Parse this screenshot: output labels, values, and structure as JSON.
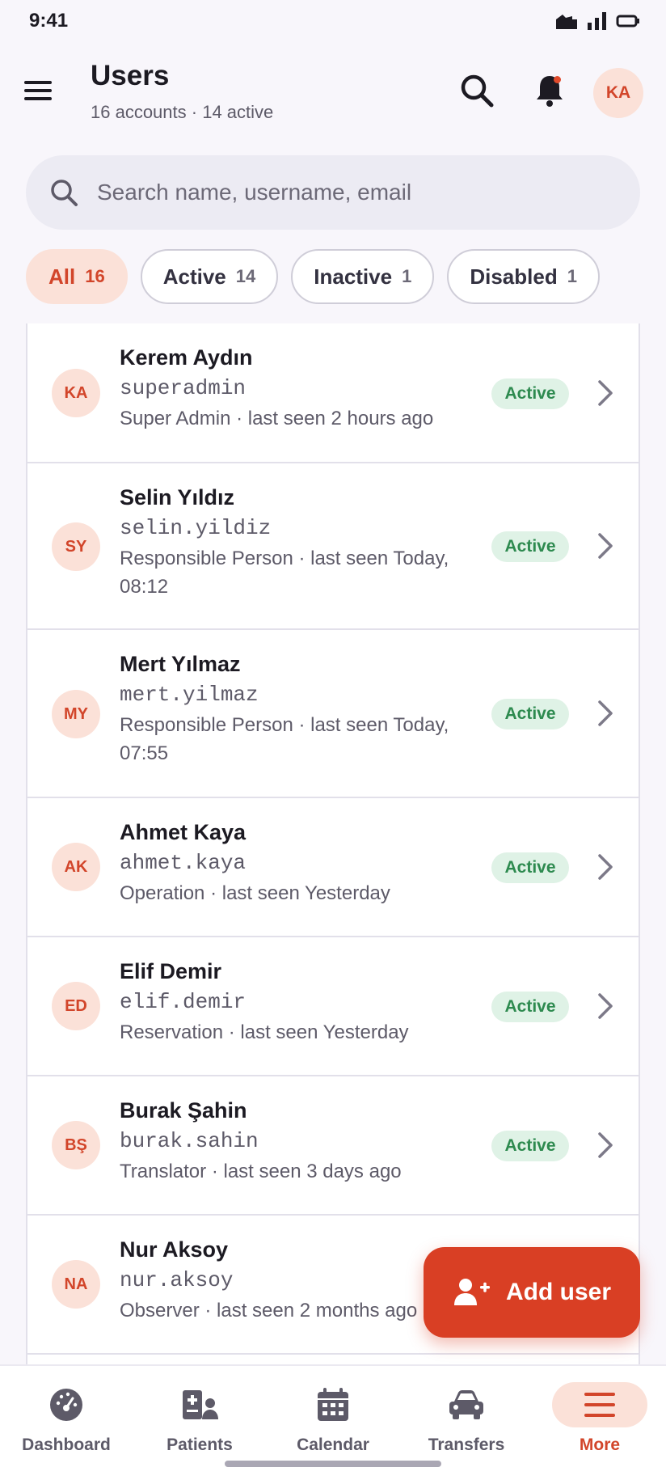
{
  "status_bar": {
    "time": "9:41"
  },
  "header": {
    "title": "Users",
    "subtitle_accounts": "16 accounts",
    "subtitle_sep": "·",
    "subtitle_active": "14 active",
    "avatar_initials": "KA"
  },
  "search": {
    "placeholder": "Search name, username, email"
  },
  "filters": [
    {
      "label": "All",
      "count": "16",
      "selected": true
    },
    {
      "label": "Active",
      "count": "14",
      "selected": false
    },
    {
      "label": "Inactive",
      "count": "1",
      "selected": false
    },
    {
      "label": "Disabled",
      "count": "1",
      "selected": false
    }
  ],
  "users": [
    {
      "initials": "KA",
      "name": "Kerem Aydın",
      "username": "superadmin",
      "role": "Super Admin",
      "last_seen": "last seen 2 hours ago",
      "status": "Active"
    },
    {
      "initials": "SY",
      "name": "Selin Yıldız",
      "username": "selin.yildiz",
      "role": "Responsible Person",
      "last_seen": "last seen Today, 08:12",
      "status": "Active"
    },
    {
      "initials": "MY",
      "name": "Mert Yılmaz",
      "username": "mert.yilmaz",
      "role": "Responsible Person",
      "last_seen": "last seen Today, 07:55",
      "status": "Active"
    },
    {
      "initials": "AK",
      "name": "Ahmet Kaya",
      "username": "ahmet.kaya",
      "role": "Operation",
      "last_seen": "last seen Yesterday",
      "status": "Active"
    },
    {
      "initials": "ED",
      "name": "Elif Demir",
      "username": "elif.demir",
      "role": "Reservation",
      "last_seen": "last seen Yesterday",
      "status": "Active"
    },
    {
      "initials": "BŞ",
      "name": "Burak Şahin",
      "username": "burak.sahin",
      "role": "Translator",
      "last_seen": "last seen 3 days ago",
      "status": "Active"
    },
    {
      "initials": "NA",
      "name": "Nur Aksoy",
      "username": "nur.aksoy",
      "role": "Observer",
      "last_seen": "last seen 2 months ago",
      "status": ""
    }
  ],
  "fab": {
    "label": "Add user"
  },
  "bottom_nav": [
    {
      "label": "Dashboard",
      "icon": "dashboard-icon",
      "active": false
    },
    {
      "label": "Patients",
      "icon": "patients-icon",
      "active": false
    },
    {
      "label": "Calendar",
      "icon": "calendar-icon",
      "active": false
    },
    {
      "label": "Transfers",
      "icon": "car-icon",
      "active": false
    },
    {
      "label": "More",
      "icon": "menu-icon",
      "active": true
    }
  ],
  "colors": {
    "accent": "#d93f24",
    "accent_soft": "#fbe1d8",
    "active_badge_bg": "#dff2e6",
    "active_badge_text": "#2d8a4f",
    "muted": "#5d5a68"
  }
}
